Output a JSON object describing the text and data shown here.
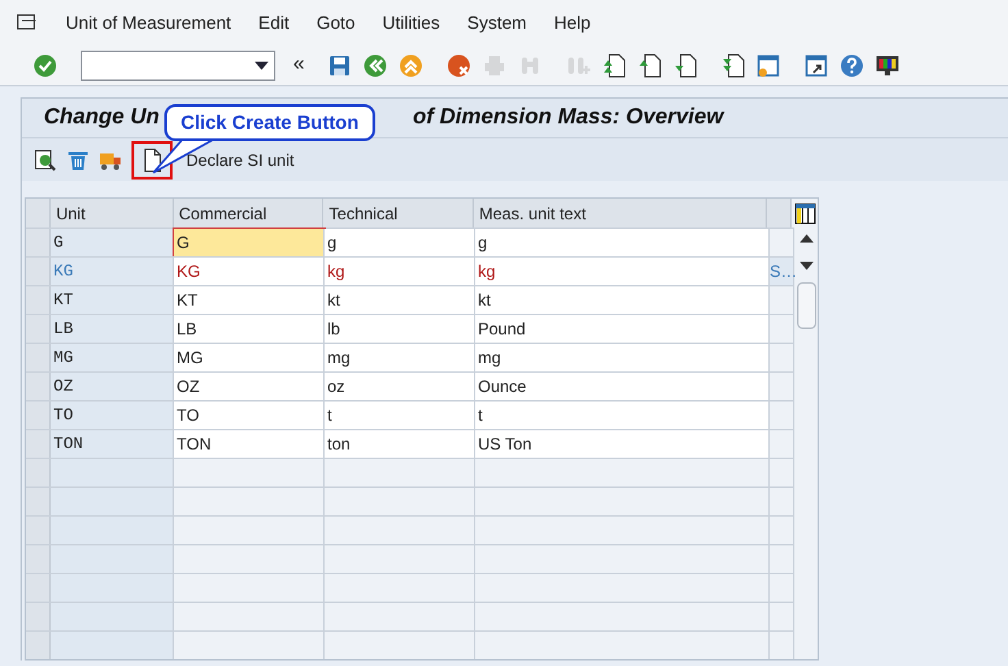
{
  "menu_bar": {
    "items": [
      "Unit of Measurement",
      "Edit",
      "Goto",
      "Utilities",
      "System",
      "Help"
    ]
  },
  "toolbar": {
    "collapse": "«",
    "buttons": [
      {
        "kind": "save",
        "disabled": false
      },
      {
        "kind": "back",
        "disabled": false
      },
      {
        "kind": "exit",
        "disabled": false
      },
      {
        "kind": "cancel",
        "disabled": false
      },
      {
        "kind": "print",
        "disabled": true
      },
      {
        "kind": "find",
        "disabled": true
      },
      {
        "kind": "find-next",
        "disabled": true
      },
      {
        "kind": "first-page",
        "disabled": false
      },
      {
        "kind": "previous-page",
        "disabled": false
      },
      {
        "kind": "next-page",
        "disabled": false
      },
      {
        "kind": "last-page",
        "disabled": false
      },
      {
        "kind": "new-session",
        "disabled": false
      },
      {
        "kind": "shortcut",
        "disabled": false
      },
      {
        "kind": "help",
        "disabled": false
      },
      {
        "kind": "layout",
        "disabled": false
      }
    ]
  },
  "title": {
    "left": "Change Un",
    "right": "of Dimension Mass: Overview"
  },
  "app_toolbar": {
    "buttons": [
      {
        "kind": "details"
      },
      {
        "kind": "delete"
      },
      {
        "kind": "transport"
      },
      {
        "kind": "create",
        "highlighted": true
      }
    ],
    "declare_label": "Declare SI unit"
  },
  "callout": {
    "text": "Click Create Button"
  },
  "table": {
    "columns": [
      "Unit",
      "Commercial",
      "Technical",
      "Meas. unit text"
    ],
    "rows": [
      {
        "cells": [
          "G",
          "G",
          "g",
          "g"
        ],
        "si_unit": false,
        "focused": true
      },
      {
        "cells": [
          "KG",
          "KG",
          "kg",
          "kg"
        ],
        "extra": "S…",
        "si_unit": true,
        "focused": false
      },
      {
        "cells": [
          "KT",
          "KT",
          "kt",
          "kt"
        ],
        "si_unit": false,
        "focused": false
      },
      {
        "cells": [
          "LB",
          "LB",
          "lb",
          "Pound"
        ],
        "si_unit": false,
        "focused": false
      },
      {
        "cells": [
          "MG",
          "MG",
          "mg",
          "mg"
        ],
        "si_unit": false,
        "focused": false
      },
      {
        "cells": [
          "OZ",
          "OZ",
          "oz",
          "Ounce"
        ],
        "si_unit": false,
        "focused": false
      },
      {
        "cells": [
          "TO",
          "TO",
          "t",
          "t"
        ],
        "si_unit": false,
        "focused": false
      },
      {
        "cells": [
          "TON",
          "TON",
          "ton",
          "US Ton"
        ],
        "si_unit": false,
        "focused": false
      }
    ]
  }
}
